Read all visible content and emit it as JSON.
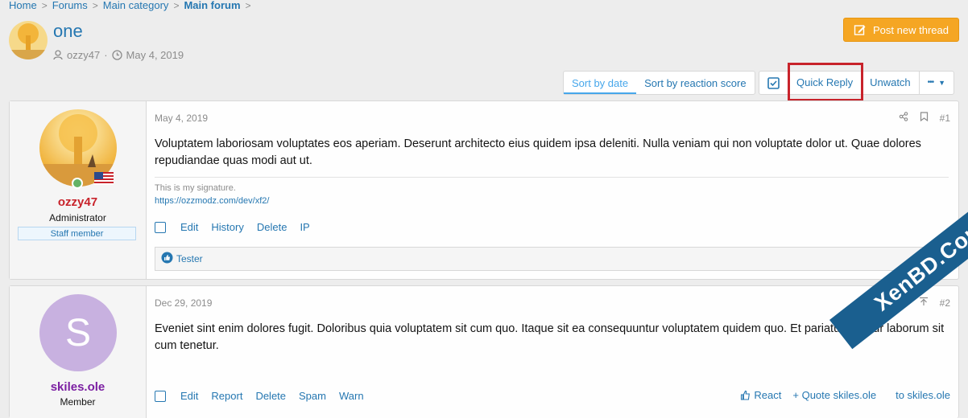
{
  "breadcrumb": [
    "Home",
    "Forums",
    "Main category",
    "Main forum"
  ],
  "thread": {
    "title": "one",
    "author": "ozzy47",
    "date": "May 4, 2019",
    "post_thread_label": "Post new thread"
  },
  "toolbar": {
    "sort_date": "Sort by date",
    "sort_reaction": "Sort by reaction score",
    "quick_reply": "Quick Reply",
    "unwatch": "Unwatch",
    "more": "•••"
  },
  "posts": [
    {
      "username": "ozzy47",
      "usertitle": "Administrator",
      "badge": "Staff member",
      "date": "May 4, 2019",
      "number": "#1",
      "body": "Voluptatem laboriosam voluptates eos aperiam. Deserunt architecto eius quidem ipsa deleniti. Nulla veniam qui non voluptate dolor ut. Quae dolores repudiandae quas modi aut ut.",
      "signature_text": "This is my signature.",
      "signature_link": "https://ozzmodz.com/dev/xf2/",
      "actions": [
        "Edit",
        "History",
        "Delete",
        "IP"
      ],
      "reaction_user": "Tester"
    },
    {
      "username": "skiles.ole",
      "usertitle": "Member",
      "avatar_letter": "S",
      "date": "Dec 29, 2019",
      "number": "#2",
      "body": "Eveniet sint enim dolores fugit. Doloribus quia voluptatem sit cum quo. Itaque sit ea consequuntur voluptatem quidem quo. Et pariatur tenetur laborum sit cum tenetur.",
      "actions": [
        "Edit",
        "Report",
        "Delete",
        "Spam",
        "Warn"
      ],
      "react": "React",
      "quote": "+ Quote skiles.ole",
      "reply": "to skiles.ole"
    }
  ],
  "watermark": "XenBD.Com",
  "colors": {
    "link": "#2577b1",
    "accent": "#f5a623",
    "username_admin": "#c8232b",
    "username_member": "#7b1fa2",
    "highlight": "#c8232b"
  }
}
